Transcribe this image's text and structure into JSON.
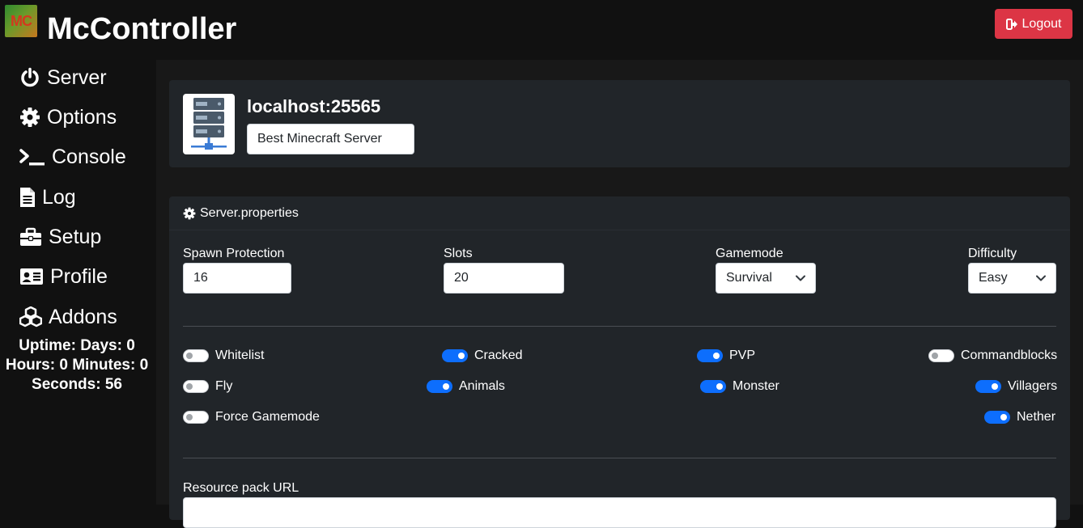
{
  "app": {
    "logo_text": "MC",
    "title": "McController",
    "logout_label": "Logout"
  },
  "sidebar": {
    "items": [
      {
        "label": "Server",
        "icon": "power-icon"
      },
      {
        "label": "Options",
        "icon": "gear-icon"
      },
      {
        "label": "Console",
        "icon": "terminal-icon"
      },
      {
        "label": "Log",
        "icon": "document-icon"
      },
      {
        "label": "Setup",
        "icon": "toolbox-icon"
      },
      {
        "label": "Profile",
        "icon": "id-card-icon"
      },
      {
        "label": "Addons",
        "icon": "cubes-icon"
      }
    ],
    "uptime": {
      "line1": "Uptime: Days: 0",
      "line2": "Hours: 0 Minutes: 0",
      "line3": "Seconds: 56"
    }
  },
  "server": {
    "address": "localhost:25565",
    "motd": "Best Minecraft Server"
  },
  "properties": {
    "header": "Server.properties",
    "spawn_protection": {
      "label": "Spawn Protection",
      "value": "16"
    },
    "slots": {
      "label": "Slots",
      "value": "20"
    },
    "gamemode": {
      "label": "Gamemode",
      "value": "Survival"
    },
    "difficulty": {
      "label": "Difficulty",
      "value": "Easy"
    },
    "toggles": {
      "whitelist": {
        "label": "Whitelist",
        "on": false
      },
      "cracked": {
        "label": "Cracked",
        "on": true
      },
      "pvp": {
        "label": "PVP",
        "on": true
      },
      "commandblocks": {
        "label": "Commandblocks",
        "on": false
      },
      "fly": {
        "label": "Fly",
        "on": false
      },
      "animals": {
        "label": "Animals",
        "on": true
      },
      "monster": {
        "label": "Monster",
        "on": true
      },
      "villagers": {
        "label": "Villagers",
        "on": true
      },
      "force_gamemode": {
        "label": "Force Gamemode",
        "on": false
      },
      "nether": {
        "label": "Nether",
        "on": true
      }
    },
    "resource_pack_label": "Resource pack URL"
  },
  "colors": {
    "accent": "#0d6efd",
    "danger": "#dc3545",
    "card": "#212529",
    "background": "#111111"
  }
}
